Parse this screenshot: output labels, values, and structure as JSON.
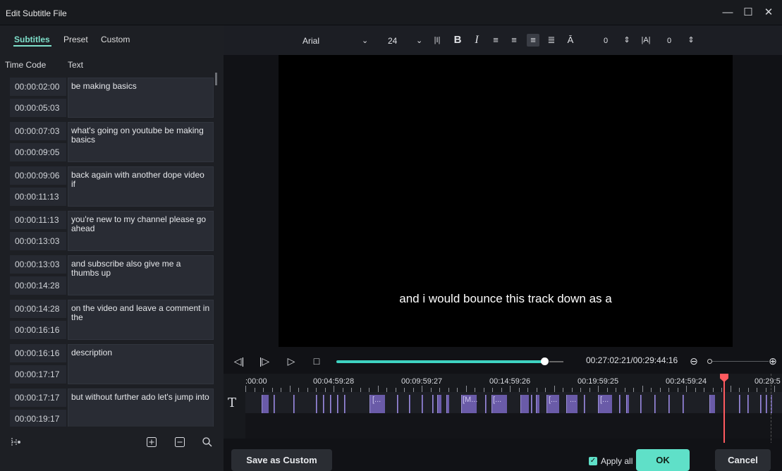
{
  "window": {
    "title": "Edit Subtitle File",
    "controls": {
      "minimize": "—",
      "maximize": "☐",
      "close": "✕"
    }
  },
  "left_tabs": [
    {
      "label": "Subtitles",
      "active": true
    },
    {
      "label": "Preset",
      "active": false
    },
    {
      "label": "Custom",
      "active": false
    }
  ],
  "columns": {
    "time": "Time Code",
    "text": "Text"
  },
  "subtitles": [
    {
      "start": "00:00:02:00",
      "end": "00:00:05:03",
      "text": "be making basics"
    },
    {
      "start": "00:00:07:03",
      "end": "00:00:09:05",
      "text": "what's going on youtube be making basics"
    },
    {
      "start": "00:00:09:06",
      "end": "00:00:11:13",
      "text": "back again with another dope video if"
    },
    {
      "start": "00:00:11:13",
      "end": "00:00:13:03",
      "text": "you're new to my channel please go ahead"
    },
    {
      "start": "00:00:13:03",
      "end": "00:00:14:28",
      "text": "and subscribe also give me a thumbs up"
    },
    {
      "start": "00:00:14:28",
      "end": "00:00:16:16",
      "text": "on the video and leave a comment in the"
    },
    {
      "start": "00:00:16:16",
      "end": "00:00:17:17",
      "text": "description"
    },
    {
      "start": "00:00:17:17",
      "end": "00:00:19:17",
      "text": "but without further ado let's jump into"
    }
  ],
  "toolbar": {
    "font": "Arial",
    "font_size": "24",
    "bold": "B",
    "italic": "I",
    "opacity_value": "0",
    "spacing_value": "0",
    "selected_alignment": "center"
  },
  "preview": {
    "caption": "and i would bounce this track down as a"
  },
  "playback": {
    "progress": 0.915,
    "timecode": "00:27:02:21/00:29:44:16"
  },
  "timeline": {
    "ruler_labels": [
      ":00:00",
      "00:04:59:28",
      "00:09:59:27",
      "00:14:59:26",
      "00:19:59:25",
      "00:24:59:24",
      "00:29:5"
    ],
    "track_icon": "T",
    "segment_labels": [
      "[...",
      "[M...",
      "[...",
      "[...",
      "...",
      "[..."
    ]
  },
  "left_bottom": {
    "icons": [
      "split-icon",
      "add-icon",
      "remove-icon",
      "search-icon"
    ]
  },
  "footer": {
    "save_custom": "Save as Custom",
    "apply_all": "Apply all",
    "ok": "OK",
    "cancel": "Cancel"
  },
  "colors": {
    "accent": "#5fe0c8",
    "playhead": "#ff5a5f",
    "segment": "#6a5ba8"
  }
}
